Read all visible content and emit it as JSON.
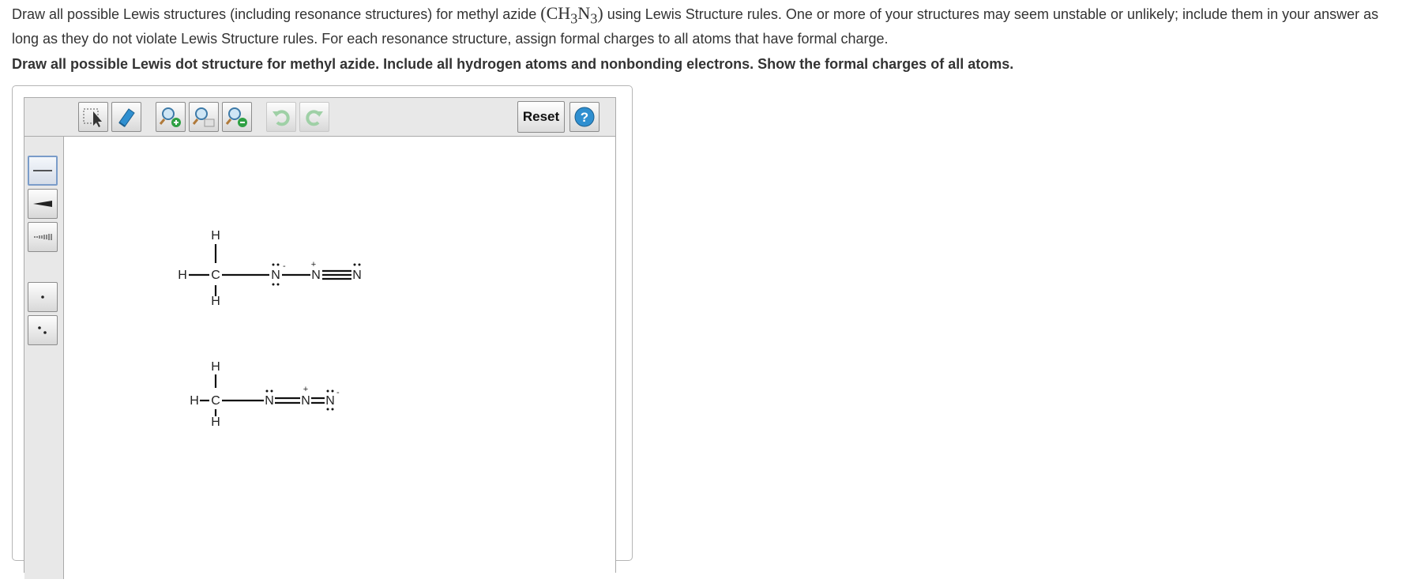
{
  "question": {
    "prefix": "Draw all possible Lewis structures (including resonance structures) for methyl azide ",
    "formula_open": "(CH",
    "sub1": "3",
    "formula_mid": "N",
    "sub2": "3",
    "formula_close": ")",
    "suffix": " using Lewis Structure rules. One or more of your structures may seem unstable or unlikely; include them in your answer as long as they do not violate Lewis Structure rules. For each resonance structure, assign formal charges to all atoms that have formal charge."
  },
  "instruction": "Draw all possible Lewis dot structure for methyl azide. Include all hydrogen atoms and nonbonding electrons. Show the formal charges of all atoms.",
  "toolbar": {
    "reset_label": "Reset",
    "help_label": "?",
    "buttons": [
      "select-icon",
      "eraser-icon",
      "zoom-in-icon",
      "zoom-reset-icon",
      "zoom-out-icon",
      "undo-icon",
      "redo-icon"
    ]
  },
  "left_tools": [
    "single-bond-icon",
    "wedge-bond-icon",
    "hash-bond-icon",
    "single-electron-icon",
    "electron-pair-icon"
  ],
  "structure1": {
    "atoms": {
      "h_top": "H",
      "h_left": "H",
      "c": "C",
      "h_bottom": "H",
      "n1": "N",
      "n2": "N",
      "n3": "N"
    },
    "charges": {
      "n1": "-",
      "n2": "+"
    }
  },
  "structure2": {
    "atoms": {
      "h_top": "H",
      "h_left": "H",
      "c": "C",
      "h_bottom": "H",
      "n1": "N",
      "n2": "N",
      "n3": "N"
    },
    "charges": {
      "n2": "+",
      "n3": "-"
    }
  },
  "colors": {
    "panel": "#e8e8e8",
    "border": "#aaaaaa",
    "help_blue": "#2f8fd0",
    "green": "#2ea043",
    "undo_green": "#9fd0a6"
  }
}
